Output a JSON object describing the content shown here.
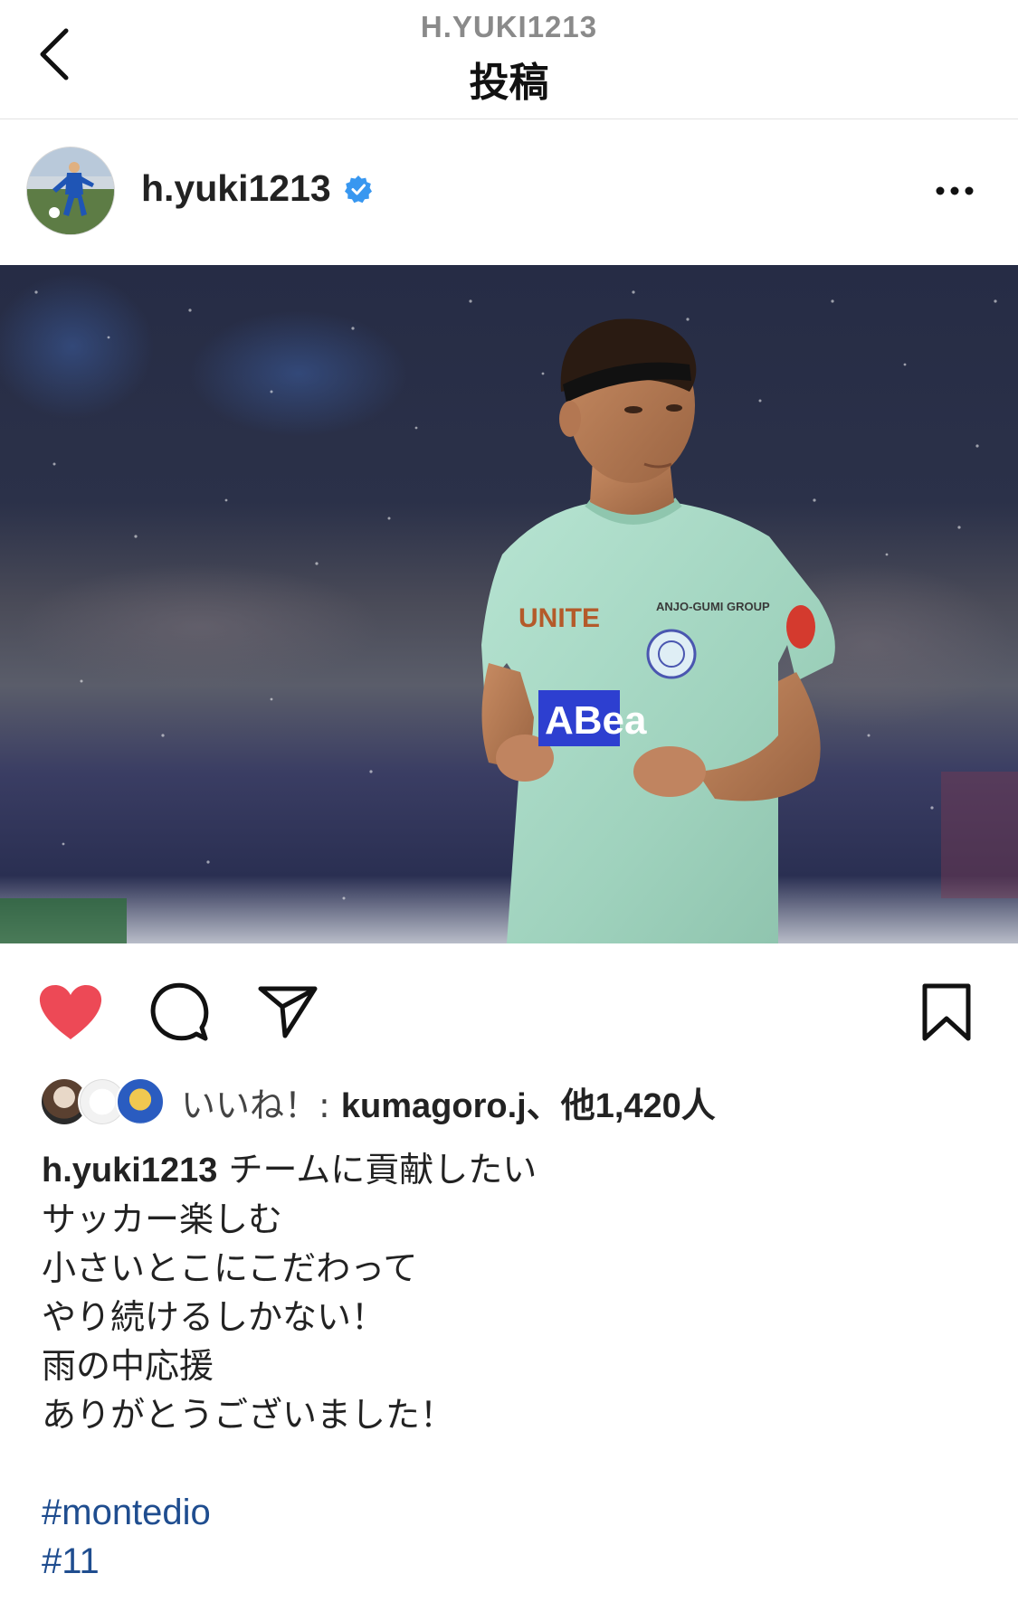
{
  "nav": {
    "subtitle": "H.YUKI1213",
    "title": "投稿",
    "back_icon": "chevron-left-icon"
  },
  "post": {
    "username": "h.yuki1213",
    "verified_icon": "verified-badge-icon",
    "more_icon": "more-horizontal-icon",
    "verified_color": "#3897f0"
  },
  "photo": {
    "jersey_texts": {
      "brand": "UNITE",
      "group": "ANJO-GUMI GROUP",
      "sponsor": "ABea"
    },
    "jersey_color": "#a9dbc7"
  },
  "actions": {
    "like_icon": "heart-filled-icon",
    "comment_icon": "comment-icon",
    "share_icon": "send-icon",
    "save_icon": "bookmark-icon",
    "liked": true,
    "like_color": "#ed4956"
  },
  "likes": {
    "prefix": "いいね！: ",
    "bold_text": "kumagoro.j、他1,420人"
  },
  "caption": {
    "username": "h.yuki1213",
    "lines": [
      "チームに貢献したい",
      "サッカー楽しむ",
      "小さいとこにこだわって",
      "やり続けるしかない！",
      "雨の中応援",
      "ありがとうございました！"
    ],
    "hashtags": [
      "#montedio",
      "#11"
    ],
    "hashtag_color": "#1f4d8f"
  }
}
